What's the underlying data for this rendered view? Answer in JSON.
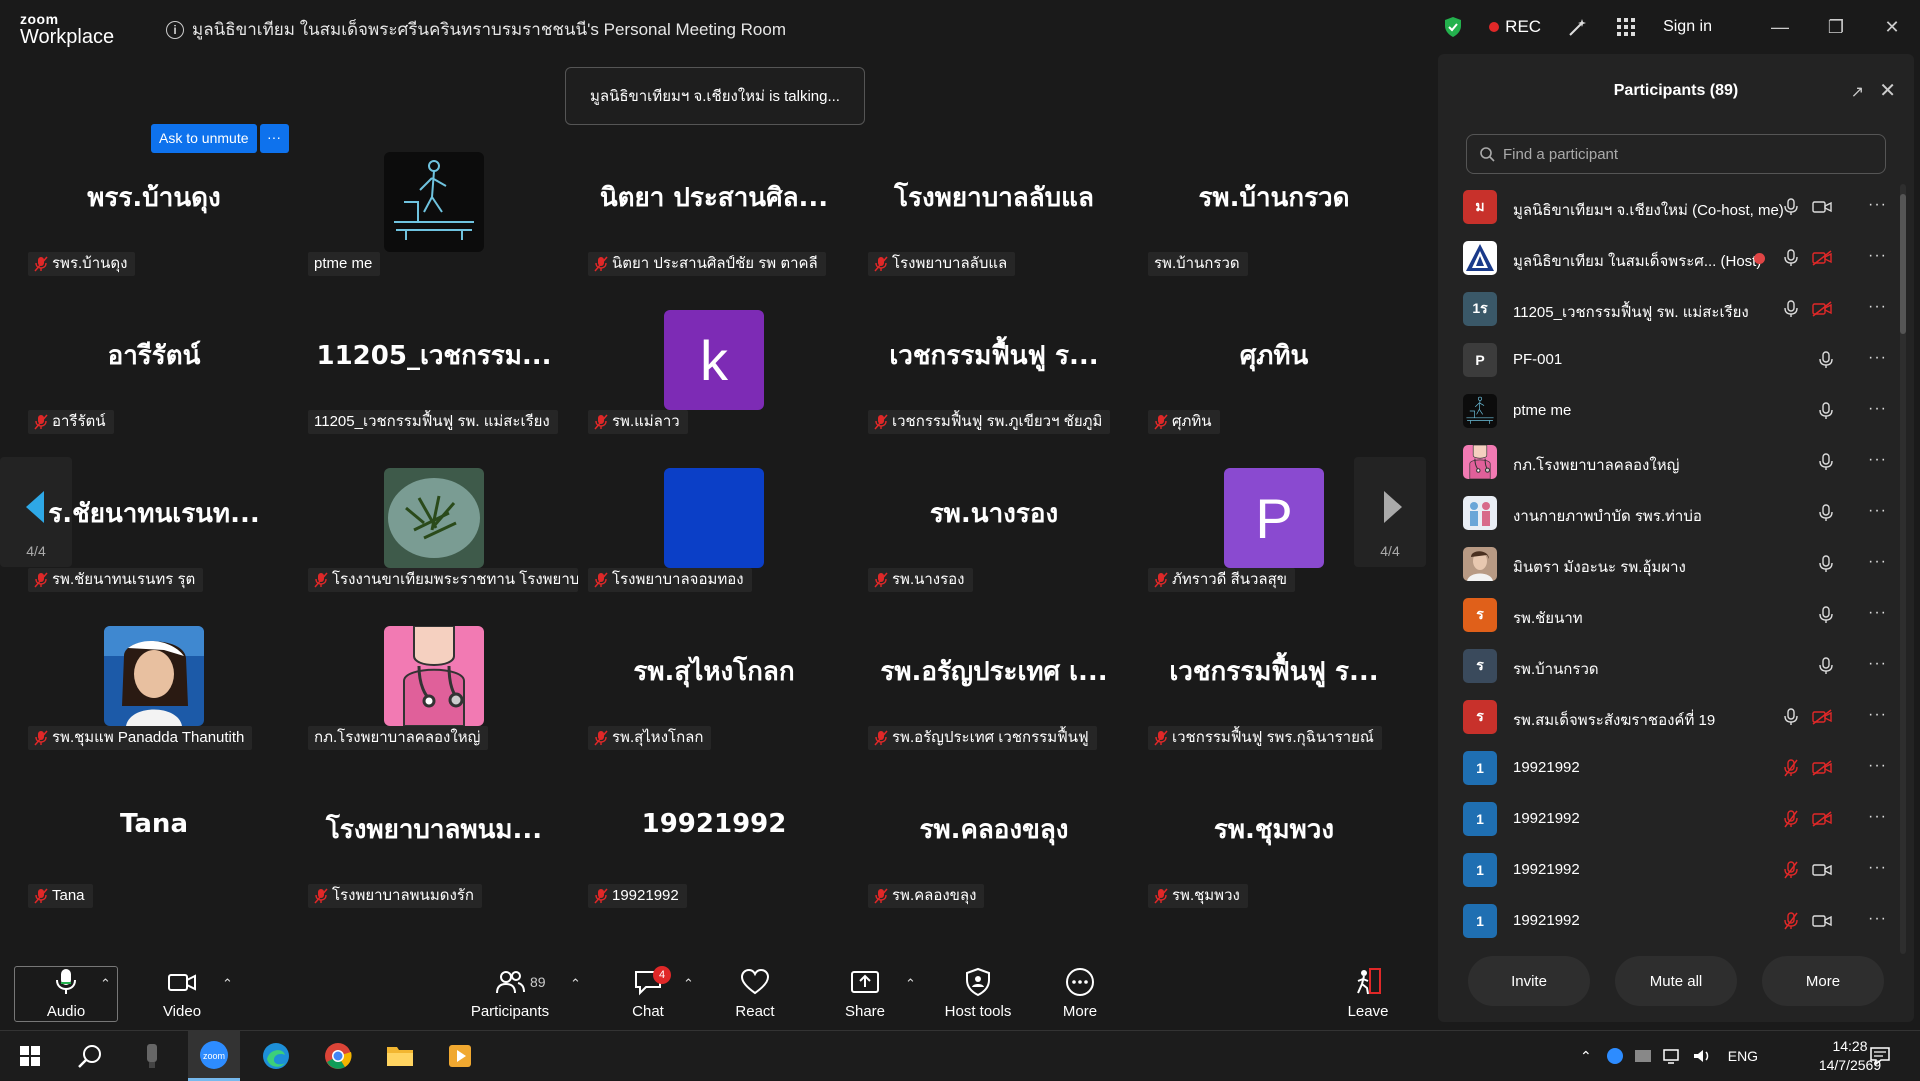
{
  "window": {
    "logo_top": "zoom",
    "logo_bottom": "Workplace",
    "meeting_title": "มูลนิธิขาเทียม ในสมเด็จพระศรีนครินทราบรมราชชนนี's Personal Meeting Room",
    "rec_label": "REC",
    "signin_label": "Sign in"
  },
  "gallery": {
    "talking_banner": "มูลนิธิขาเทียมฯ จ.เชียงใหม่ is talking...",
    "ask_to_unmute": "Ask to unmute",
    "ask_more": "···",
    "left_page": "4/4",
    "right_page": "4/4",
    "tiles": [
      {
        "big": "พรร.บ้านดุง",
        "label": "รพร.บ้านดุง",
        "muted": true,
        "avatar": null
      },
      {
        "big": "",
        "label": "ptme me",
        "muted": false,
        "avatar": "treadmill"
      },
      {
        "big": "นิตยา ประสานศิล...",
        "label": "นิตยา ประสานศิลป์ชัย รพ ตาคลี",
        "muted": true,
        "avatar": null
      },
      {
        "big": "โรงพยาบาลลับแล",
        "label": "โรงพยาบาลลับแล",
        "muted": true,
        "avatar": null
      },
      {
        "big": "รพ.บ้านกรวด",
        "label": "รพ.บ้านกรวด",
        "muted": false,
        "avatar": null
      },
      {
        "big": "อารีรัตน์",
        "label": "อารีรัตน์",
        "muted": true,
        "avatar": null
      },
      {
        "big": "11205_เวชกรรม...",
        "label": "11205_เวชกรรมฟื้นฟู รพ. แม่สะเรียง",
        "muted": false,
        "avatar": null
      },
      {
        "big": "",
        "label": "รพ.แม่ลาว",
        "muted": true,
        "avatar": "k",
        "avatar_color": "#7d2bb5"
      },
      {
        "big": "เวชกรรมฟื้นฟู ร...",
        "label": "เวชกรรมฟื้นฟู รพ.ภูเขียวฯ ชัยภูมิ",
        "muted": true,
        "avatar": null
      },
      {
        "big": "ศุภทิน",
        "label": "ศุภทิน",
        "muted": true,
        "avatar": null
      },
      {
        "big": "ร.ชัยนาทนเรนท...",
        "label": "รพ.ชัยนาทนเรนทร รุต",
        "muted": true,
        "avatar": null
      },
      {
        "big": "",
        "label": "โรงงานขาเทียมพระราชทาน โรงพยาบาล...",
        "muted": true,
        "avatar": "plate"
      },
      {
        "big": "",
        "label": "โรงพยาบาลจอมทอง",
        "muted": true,
        "avatar": "blue",
        "avatar_color": "#0b3fc7"
      },
      {
        "big": "รพ.นางรอง",
        "label": "รพ.นางรอง",
        "muted": true,
        "avatar": null
      },
      {
        "big": "",
        "label": "ภัทราวดี สีนวลสุข",
        "muted": true,
        "avatar": "P",
        "avatar_color": "#8a4ad0"
      },
      {
        "big": "",
        "label": "รพ.ชุมแพ Panadda Thanutith",
        "muted": true,
        "avatar": "woman"
      },
      {
        "big": "",
        "label": "กภ.โรงพยาบาลคลองใหญ่",
        "muted": false,
        "avatar": "nurse"
      },
      {
        "big": "รพ.สุไหงโกลก",
        "label": "รพ.สุไหงโกลก",
        "muted": true,
        "avatar": null
      },
      {
        "big": "รพ.อรัญประเทศ เ...",
        "label": "รพ.อรัญประเทศ เวชกรรมฟื้นฟู",
        "muted": true,
        "avatar": null
      },
      {
        "big": "เวชกรรมฟื้นฟู ร...",
        "label": "เวชกรรมฟื้นฟู รพร.กุฉินารายณ์",
        "muted": true,
        "avatar": null
      },
      {
        "big": "Tana",
        "label": "Tana",
        "muted": true,
        "avatar": null
      },
      {
        "big": "โรงพยาบาลพนม...",
        "label": "โรงพยาบาลพนมดงรัก",
        "muted": true,
        "avatar": null
      },
      {
        "big": "19921992",
        "label": "19921992",
        "muted": true,
        "avatar": null
      },
      {
        "big": "รพ.คลองขลุง",
        "label": "รพ.คลองขลุง",
        "muted": true,
        "avatar": null
      },
      {
        "big": "รพ.ชุมพวง",
        "label": "รพ.ชุมพวง",
        "muted": true,
        "avatar": null
      }
    ]
  },
  "toolbar": {
    "audio": "Audio",
    "video": "Video",
    "participants": "Participants",
    "participants_count": "89",
    "chat": "Chat",
    "chat_badge": "4",
    "react": "React",
    "share": "Share",
    "host_tools": "Host tools",
    "more": "More",
    "leave": "Leave"
  },
  "panel": {
    "title": "Participants (89)",
    "search_placeholder": "Find a participant",
    "invite": "Invite",
    "mute_all": "Mute all",
    "more": "More",
    "participants": [
      {
        "name": "มูลนิธิขาเทียมฯ จ.เชียงใหม่ (Co-host, me)",
        "initial": "ม",
        "color": "#c8312b",
        "mic": "on",
        "cam": "on",
        "avatar": null
      },
      {
        "name": "มูลนิธิขาเทียม ในสมเด็จพระศ... (Host)",
        "initial": "",
        "color": "#ffffff",
        "mic": "on",
        "cam": "off",
        "avatar": "logo",
        "recording": true
      },
      {
        "name": "11205_เวชกรรมฟื้นฟู รพ. แม่สะเรียง",
        "initial": "1ร",
        "color": "#3a5868",
        "mic": "on",
        "cam": "off",
        "avatar": null
      },
      {
        "name": "PF-001",
        "initial": "P",
        "color": "#3c3c3c",
        "mic": "on",
        "cam": "none",
        "avatar": null
      },
      {
        "name": "ptme me",
        "initial": "",
        "color": "#111111",
        "mic": "on",
        "cam": "none",
        "avatar": "treadmill"
      },
      {
        "name": "กภ.โรงพยาบาลคลองใหญ่",
        "initial": "",
        "color": "#f48fb1",
        "mic": "on",
        "cam": "none",
        "avatar": "nurse"
      },
      {
        "name": "งานกายภาพบำบัด รพร.ท่าบ่อ",
        "initial": "",
        "color": "#e9eef5",
        "mic": "on",
        "cam": "none",
        "avatar": "people"
      },
      {
        "name": "มินตรา มังอะนะ รพ.อุ้มผาง",
        "initial": "",
        "color": "#b89a84",
        "mic": "on",
        "cam": "none",
        "avatar": "photo"
      },
      {
        "name": "รพ.ชัยนาท",
        "initial": "ร",
        "color": "#e0601a",
        "mic": "on",
        "cam": "none",
        "avatar": null
      },
      {
        "name": "รพ.บ้านกรวด",
        "initial": "ร",
        "color": "#3a4a5c",
        "mic": "on",
        "cam": "none",
        "avatar": null
      },
      {
        "name": "รพ.สมเด็จพระสังฆราชองค์ที่ 19",
        "initial": "ร",
        "color": "#c8312b",
        "mic": "on",
        "cam": "off",
        "avatar": null
      },
      {
        "name": "19921992",
        "initial": "1",
        "color": "#1f6fb2",
        "mic": "off",
        "cam": "off",
        "avatar": null
      },
      {
        "name": "19921992",
        "initial": "1",
        "color": "#1f6fb2",
        "mic": "off",
        "cam": "off",
        "avatar": null
      },
      {
        "name": "19921992",
        "initial": "1",
        "color": "#1f6fb2",
        "mic": "off",
        "cam": "on",
        "avatar": null
      },
      {
        "name": "19921992",
        "initial": "1",
        "color": "#1f6fb2",
        "mic": "off",
        "cam": "on",
        "avatar": null
      }
    ]
  },
  "taskbar": {
    "lang": "ENG",
    "time": "14:28",
    "date": "14/7/2569"
  }
}
